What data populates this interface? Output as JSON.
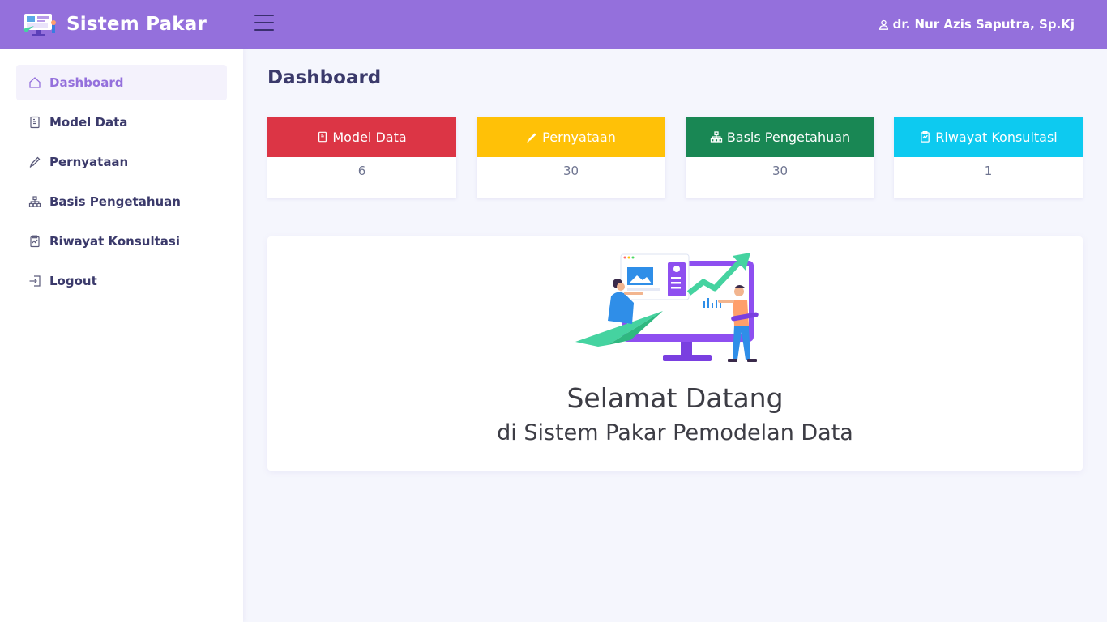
{
  "app": {
    "title": "Sistem Pakar",
    "brand_color": "#9470dc"
  },
  "header": {
    "user_name": "dr. Nur Azis Saputra, Sp.Kj",
    "menu_icon": "hamburger-icon",
    "user_icon": "user-icon"
  },
  "sidebar": {
    "items": [
      {
        "label": "Dashboard",
        "icon": "home-icon",
        "active": true
      },
      {
        "label": "Model Data",
        "icon": "file-icon",
        "active": false
      },
      {
        "label": "Pernyataan",
        "icon": "pencil-icon",
        "active": false
      },
      {
        "label": "Basis Pengetahuan",
        "icon": "hierarchy-icon",
        "active": false
      },
      {
        "label": "Riwayat Konsultasi",
        "icon": "clipboard-icon",
        "active": false
      },
      {
        "label": "Logout",
        "icon": "logout-icon",
        "active": false
      }
    ]
  },
  "main": {
    "page_title": "Dashboard",
    "cards": [
      {
        "label": "Model Data",
        "value": "6",
        "color": "#dc3545",
        "icon": "file-icon"
      },
      {
        "label": "Pernyataan",
        "value": "30",
        "color": "#ffc107",
        "icon": "pencil-icon"
      },
      {
        "label": "Basis Pengetahuan",
        "value": "30",
        "color": "#198754",
        "icon": "hierarchy-icon"
      },
      {
        "label": "Riwayat Konsultasi",
        "value": "1",
        "color": "#0dcaf0",
        "icon": "clipboard-icon"
      }
    ],
    "welcome": {
      "title": "Selamat Datang",
      "subtitle": "di Sistem Pakar Pemodelan Data",
      "illustration": "analytics-illustration"
    }
  }
}
